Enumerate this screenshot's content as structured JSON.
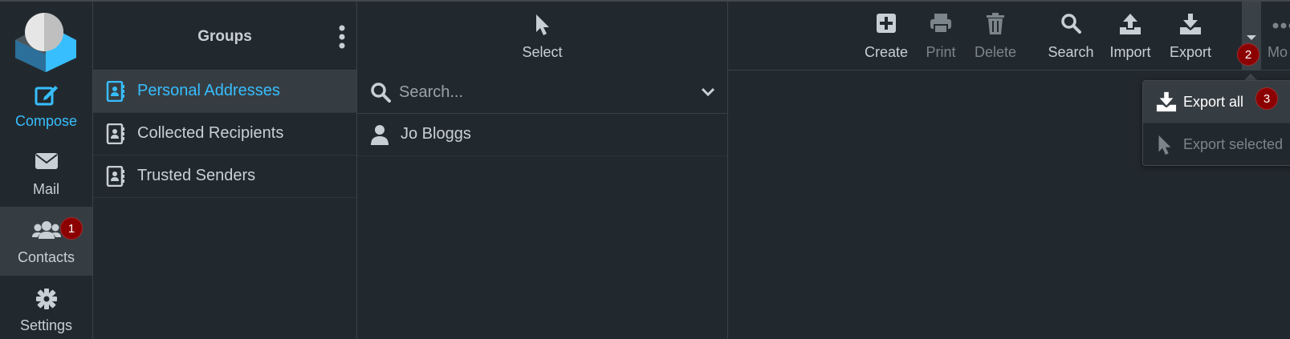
{
  "nav": {
    "items": [
      {
        "label": "Compose",
        "icon": "compose-icon"
      },
      {
        "label": "Mail",
        "icon": "envelope-icon"
      },
      {
        "label": "Contacts",
        "icon": "users-icon",
        "active": true
      },
      {
        "label": "Settings",
        "icon": "gear-icon"
      }
    ]
  },
  "badges": {
    "one": "1",
    "two": "2",
    "three": "3"
  },
  "groups": {
    "title": "Groups",
    "items": [
      {
        "label": "Personal Addresses",
        "selected": true
      },
      {
        "label": "Collected Recipients"
      },
      {
        "label": "Trusted Senders"
      }
    ]
  },
  "contacts": {
    "select_label": "Select",
    "search_placeholder": "Search...",
    "items": [
      {
        "name": "Jo Bloggs"
      }
    ]
  },
  "toolbar": {
    "create": "Create",
    "print": "Print",
    "delete": "Delete",
    "search": "Search",
    "import": "Import",
    "export": "Export",
    "more": "Mo"
  },
  "export_menu": {
    "export_all": "Export all",
    "export_selected": "Export selected"
  },
  "colors": {
    "accent": "#37beff",
    "background": "#22292e",
    "selected_bg": "#363d42",
    "badge": "#8b0000"
  }
}
